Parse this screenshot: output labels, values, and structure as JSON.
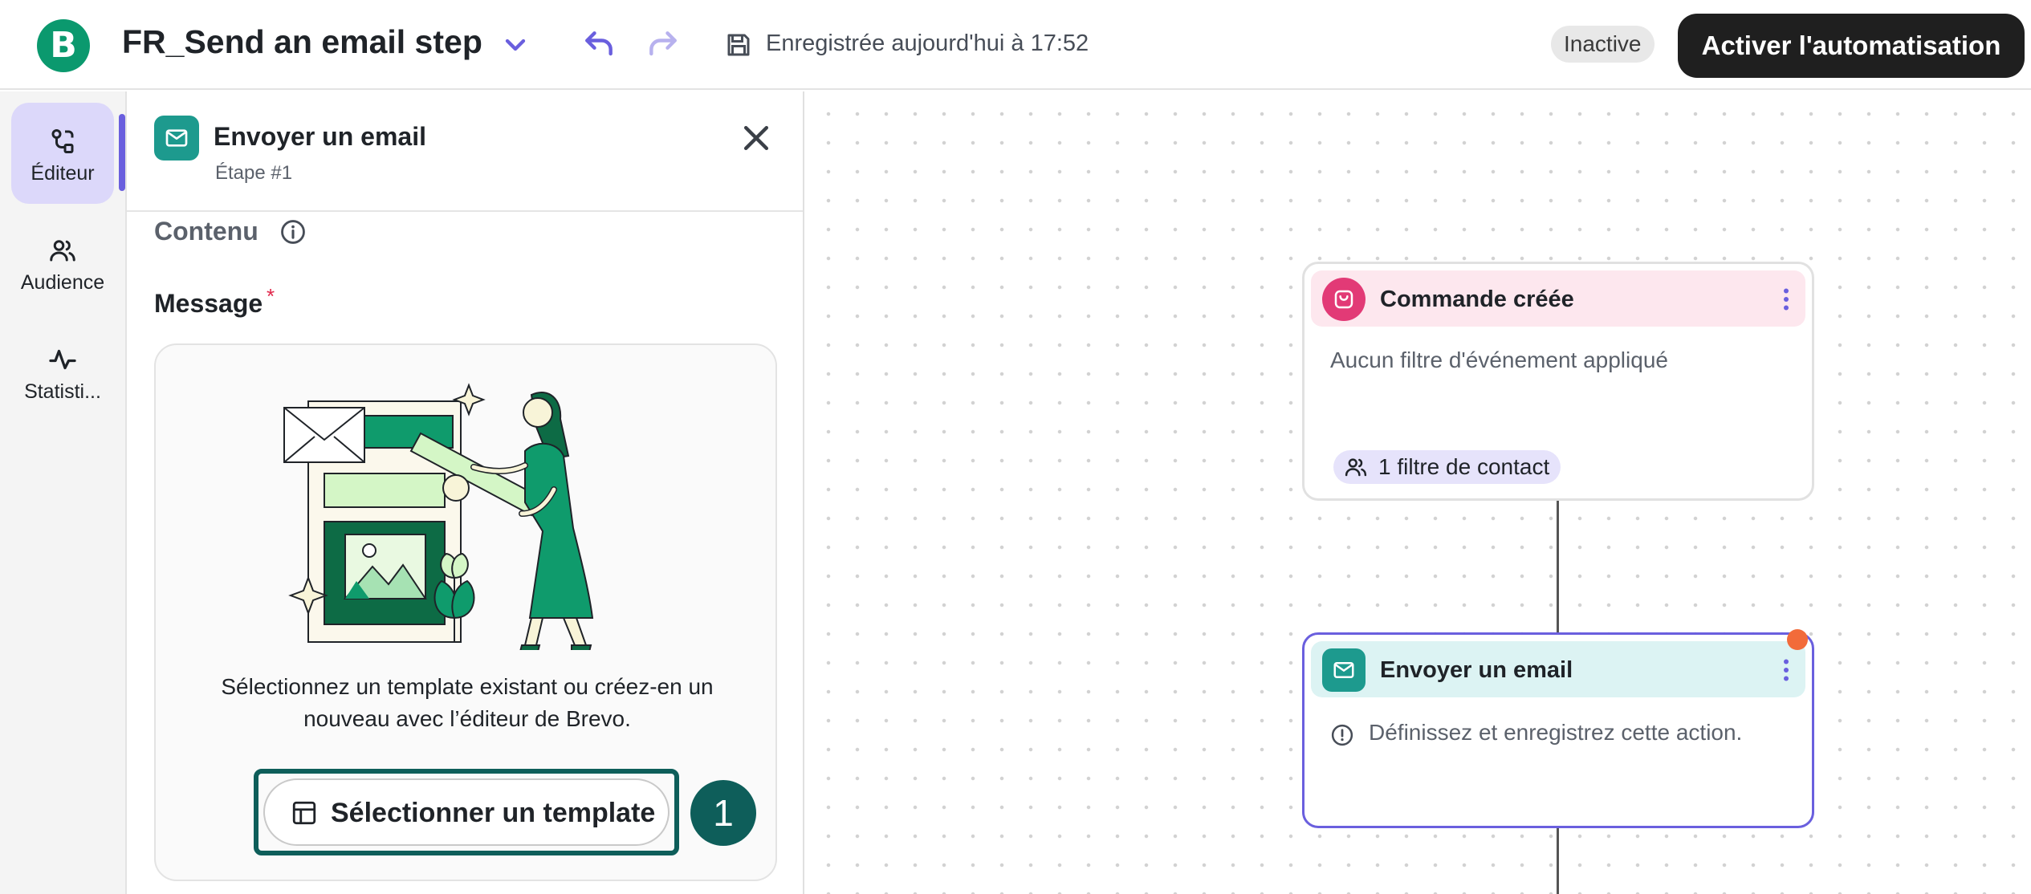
{
  "header": {
    "logo_letter": "B",
    "title": "FR_Send an email step",
    "save_status": "Enregistrée aujourd'hui à 17:52",
    "status_badge": "Inactive",
    "activate_label": "Activer l'automatisation"
  },
  "rail": {
    "items": [
      {
        "label": "Éditeur",
        "icon": "editor-icon",
        "active": true
      },
      {
        "label": "Audience",
        "icon": "audience-icon",
        "active": false
      },
      {
        "label": "Statisti...",
        "icon": "statistics-icon",
        "active": false
      }
    ]
  },
  "panel": {
    "title": "Envoyer un email",
    "subtitle": "Étape #1",
    "section_title": "Contenu",
    "field_label": "Message",
    "required_mark": "*",
    "card_text": "Sélectionnez un template existant ou créez-en un nouveau avec l’éditeur de Brevo.",
    "select_label": "Sélectionner un template",
    "step_marker": "1"
  },
  "canvas": {
    "trigger_node": {
      "title": "Commande créée",
      "description": "Aucun filtre d'événement appliqué",
      "chip_label": "1 filtre de contact"
    },
    "action_node": {
      "title": "Envoyer un email",
      "description": "Définissez et enregistrez cette action."
    }
  },
  "colors": {
    "brand_green": "#0b996e",
    "accent_purple": "#6a5fde",
    "email_teal": "#1d9a8e",
    "order_pink": "#e23a76",
    "highlight_teal": "#0e5e5a",
    "status_orange": "#f26b3a"
  }
}
